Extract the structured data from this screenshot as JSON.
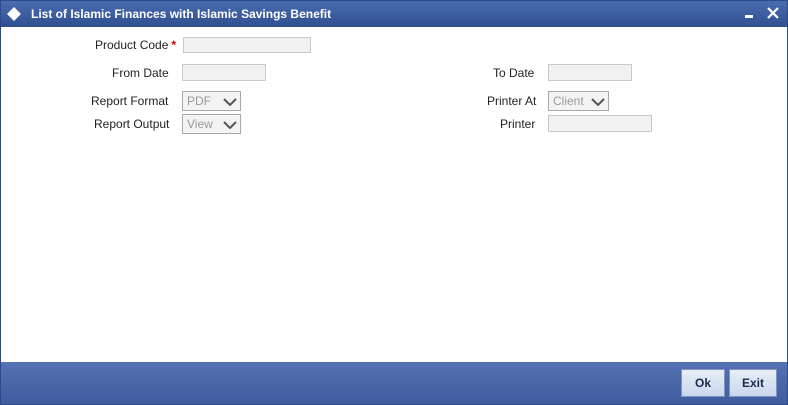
{
  "window": {
    "title": "List of Islamic Finances with Islamic Savings Benefit",
    "title_icon": "diamond-icon",
    "minimize_icon": "minimize-icon",
    "close_icon": "close-icon"
  },
  "form": {
    "product_code": {
      "label": "Product Code",
      "required_marker": "*",
      "value": ""
    },
    "from_date": {
      "label": "From Date",
      "value": ""
    },
    "to_date": {
      "label": "To Date",
      "value": ""
    },
    "report_format": {
      "label": "Report Format",
      "selected": "PDF"
    },
    "printer_at": {
      "label": "Printer At",
      "selected": "Client"
    },
    "report_output": {
      "label": "Report Output",
      "selected": "View"
    },
    "printer": {
      "label": "Printer",
      "value": ""
    }
  },
  "footer": {
    "ok_label": "Ok",
    "exit_label": "Exit"
  },
  "colors": {
    "titlebar": "#3a5a9c",
    "footer": "#4a66a8",
    "required": "#cc0000"
  }
}
